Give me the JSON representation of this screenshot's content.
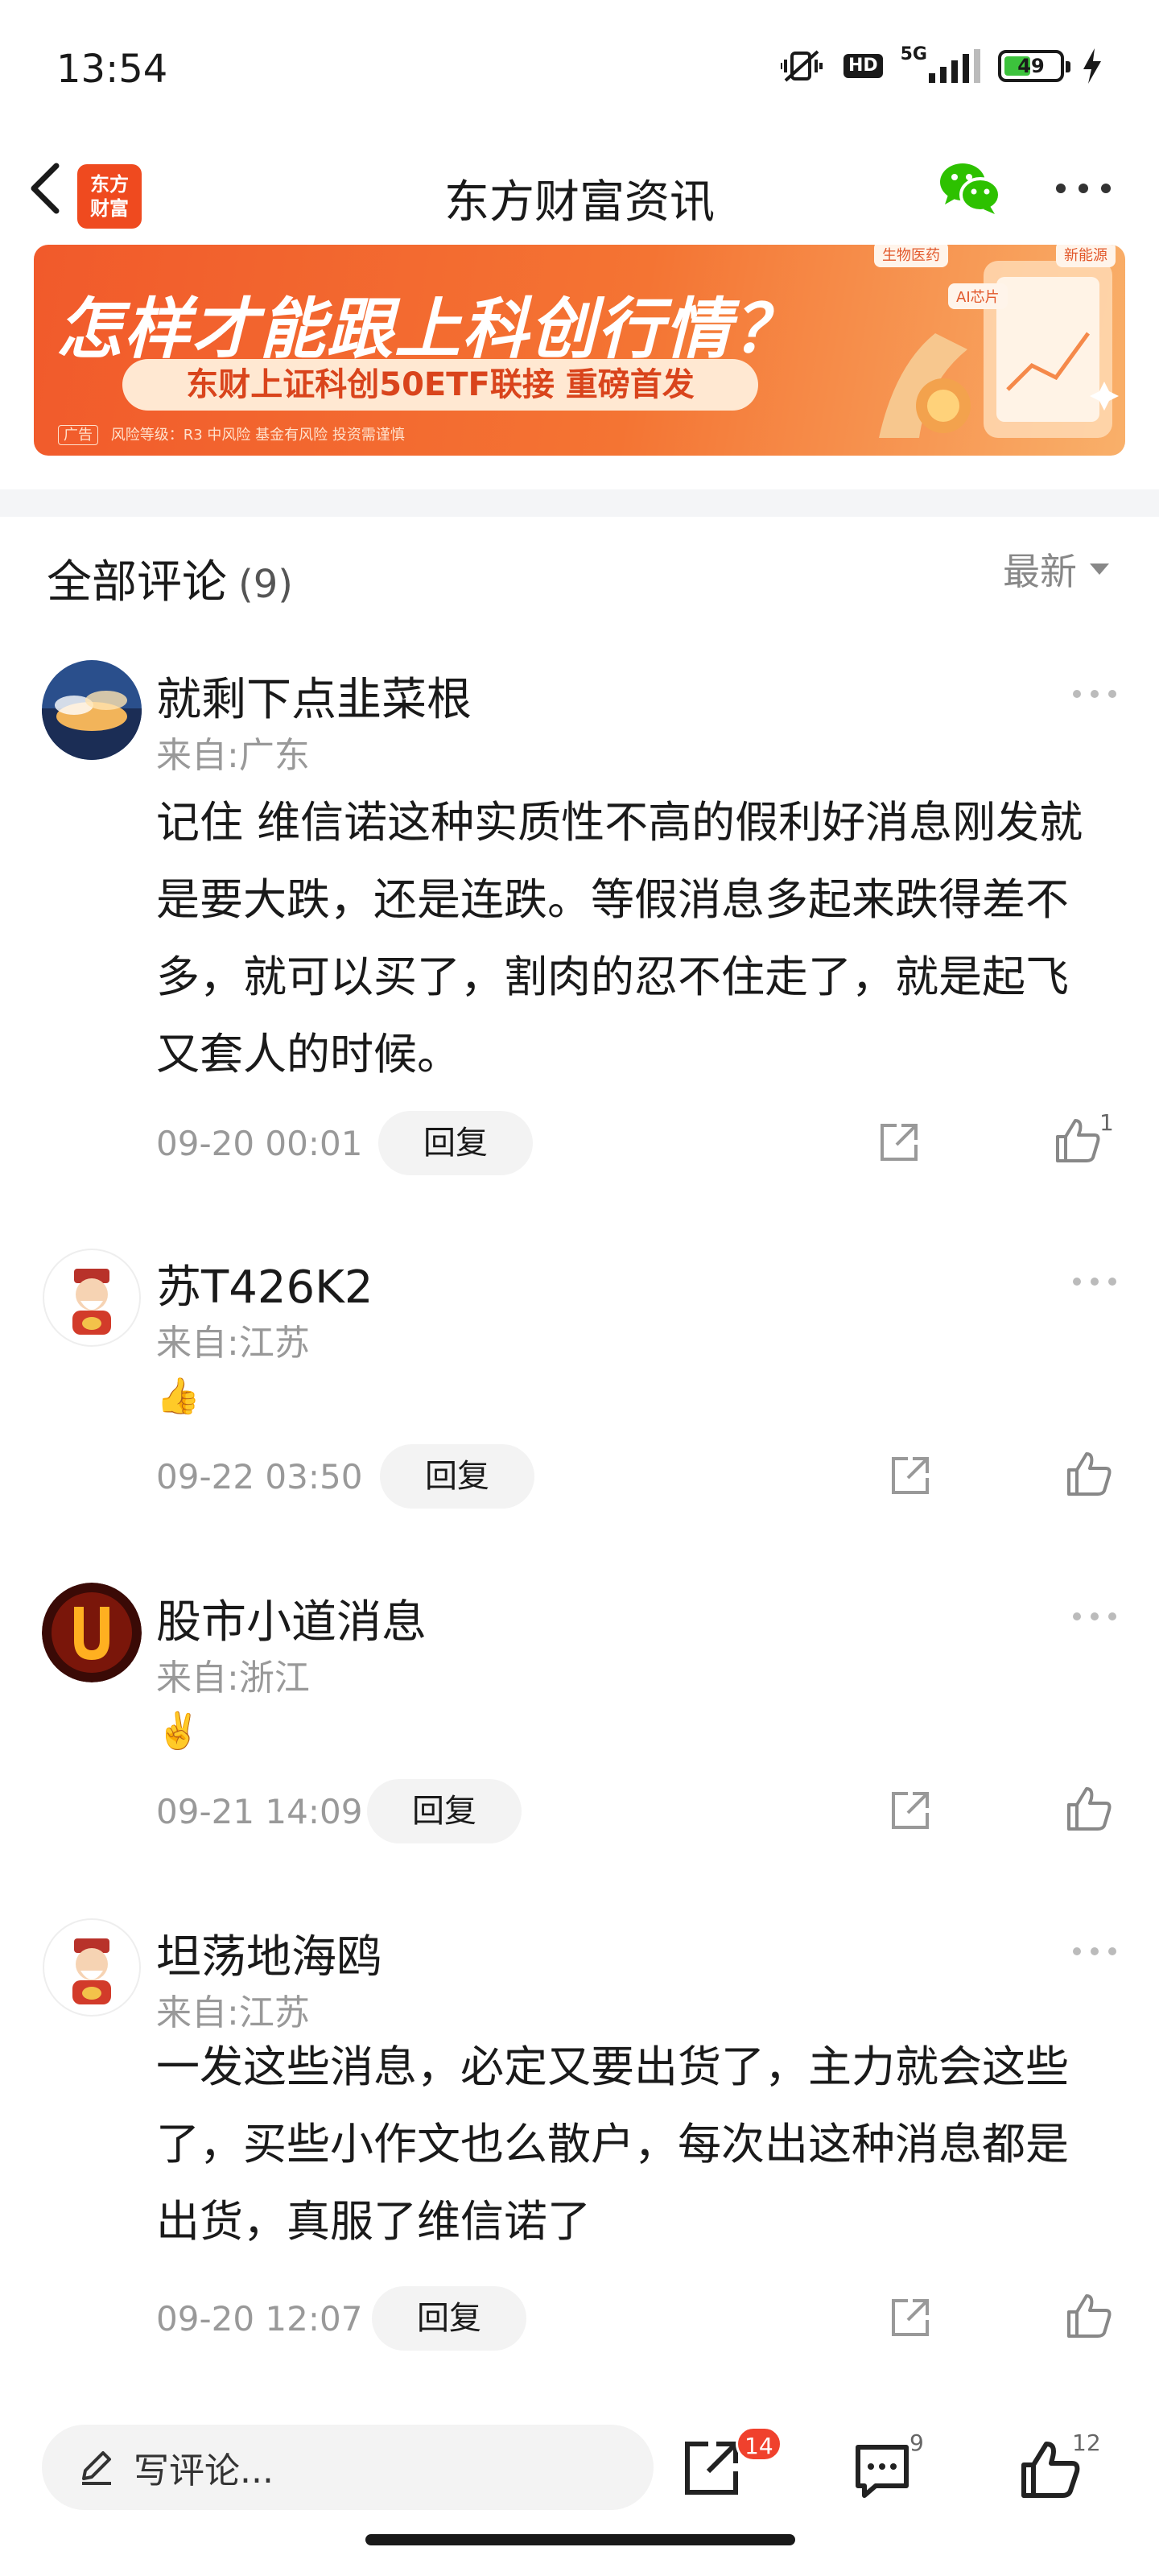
{
  "status_bar": {
    "time": "13:54",
    "hd": "HD",
    "network": "5G",
    "battery": "49",
    "battery_level": 0.49
  },
  "header": {
    "logo_line1": "东方",
    "logo_line2": "财富",
    "title": "东方财富资讯"
  },
  "banner": {
    "title": "怎样才能跟上科创行情？",
    "subtitle": "东财上证科创50ETF联接 重磅首发",
    "ad_tag": "广告",
    "disclaimer": "风险等级：R3 中风险  基金有风险 投资需谨慎",
    "tags": [
      "生物医药",
      "AI芯片",
      "新能源"
    ]
  },
  "comments_section": {
    "title": "全部评论",
    "count": "(9)",
    "sort_label": "最新"
  },
  "comments": [
    {
      "name": "就剩下点韭菜根",
      "location": "来自:广东",
      "body": "记住 维信诺这种实质性不高的假利好消息刚发就是要大跌，还是连跌。等假消息多起来跌得差不多，就可以买了，割肉的忍不住走了，就是起飞又套人的时候。",
      "time": "09-20 00:01",
      "reply_label": "回复",
      "likes": "1"
    },
    {
      "name": "苏T426K2",
      "location": "来自:江苏",
      "emoji": "👍",
      "time": "09-22 03:50",
      "reply_label": "回复",
      "likes": ""
    },
    {
      "name": "股市小道消息",
      "location": "来自:浙江",
      "emoji": "✌️",
      "time": "09-21 14:09",
      "reply_label": "回复",
      "likes": ""
    },
    {
      "name": "坦荡地海鸥",
      "location": "来自:江苏",
      "body": "一发这些消息，必定又要出货了，主力就会这些了，买些小作文也么散户，每次出这种消息都是出货，真服了维信诺了",
      "time": "09-20 12:07",
      "reply_label": "回复",
      "likes": ""
    }
  ],
  "bottom_bar": {
    "input_placeholder": "写评论...",
    "share_count": "14",
    "comment_count": "9",
    "like_count": "12"
  },
  "colors": {
    "brand": "#ef4a1f",
    "badge": "#f0412d",
    "muted": "#999999"
  }
}
